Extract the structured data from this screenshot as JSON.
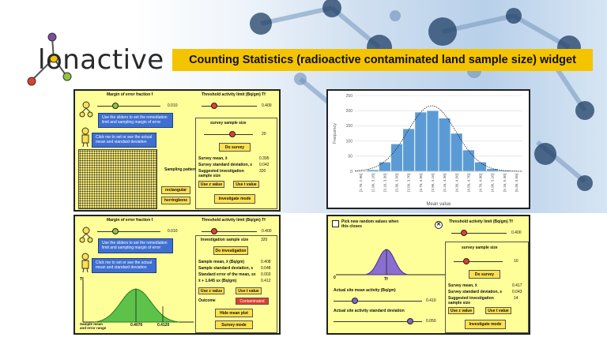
{
  "header": {
    "logo_text": "lonactive",
    "title": "Counting Statistics (radioactive contaminated land sample size) widget"
  },
  "colors": {
    "title_bg": "#f5c400",
    "panel_bg": "#ffff99",
    "button": "#ffe14d",
    "tip": "#3f6fd0",
    "contaminated": "#e0402e",
    "bar": "#5b9bd5",
    "curve": "#70ad47"
  },
  "panel1": {
    "margin_label": "Margin of error fraction f",
    "margin_value": "0.010",
    "threshold_label": "Threshold activity limit (Bq/gm) Tf",
    "threshold_value": "0.400",
    "tip1": "Use the sliders to set the remediation limit and sampling margin of error",
    "tip2": "Click me to set or see the actual mean and standard deviation",
    "sample_size_label": "survey sample size",
    "sample_size_value": "20",
    "do_survey": "Do survey",
    "survey_mean_label": "Survey mean, x̄",
    "survey_mean_value": "0.395",
    "survey_sd_label": "Survey standard deviation, s",
    "survey_sd_value": "0.042",
    "suggested_label": "Suggested investigation sample size",
    "suggested_value": "320",
    "use_z": "Use z value",
    "use_t": "Use t value",
    "investigate": "Investigate mode",
    "pattern_label": "Sampling pattern",
    "rectangular": "rectangular",
    "herringbone": "herringbone"
  },
  "panel2": {
    "margin_label": "Margin of error fraction f",
    "margin_value": "0.010",
    "threshold_label": "Threshold activity limit (Bq/gm) Tf",
    "threshold_value": "0.400",
    "tip1": "Use the sliders to set the remediation limit and sampling margin of error",
    "tip2": "Click me to set or see the actual mean and standard deviation",
    "inv_sample_label": "Investigation sample size",
    "inv_sample_value": "320",
    "do_investigation": "Do investigation",
    "sample_mean_label": "Sample mean, x̄ (Bq/gm)",
    "sample_mean_value": "0.408",
    "sample_sd_label": "Sample standard deviation, s",
    "sample_sd_value": "0.048",
    "se_label": "Standard error of the mean, sx",
    "se_value": "0.003",
    "x_plus_label": "x̄ + 1.645 sx (Bq/gm)",
    "x_plus_value": "0.412",
    "use_z": "Use z value",
    "use_t": "Use t value",
    "outcome_label": "Outcome",
    "outcome_value": "Contaminated",
    "hide_mean": "Hide mean plot",
    "survey_mode": "Survey mode",
    "tf_label": "Tf",
    "axis_label": "Sample mean and error range",
    "mean_marker": "0.4076",
    "upper_marker": "0.4120"
  },
  "panel3": {
    "checkbox_label": "Pick new random values when this closes",
    "threshold_label": "Threshold activity limit (Bq/gm) Tf",
    "threshold_value": "0.400",
    "sample_size_label": "survey sample size",
    "sample_size_value": "10",
    "do_survey": "Do survey",
    "survey_mean_label": "Survey mean, x̄",
    "survey_mean_value": "0.417",
    "survey_sd_label": "Survey standard deviation, s",
    "survey_sd_value": "0.043",
    "suggested_label": "Suggested investigation sample size",
    "suggested_value": "14",
    "use_z": "Use z value",
    "use_t": "Use t value",
    "investigate": "Investigate mode",
    "axis_zero": "0",
    "tf_label": "Tf",
    "site_mean_label": "Actual site mean activity (Bq/gm)",
    "site_mean_value": "0.410",
    "site_sd_label": "Actual site activity standard deviation",
    "site_sd_value": "0.050"
  },
  "chart_data": {
    "type": "bar",
    "title": "",
    "xlabel": "Mean value",
    "ylabel": "Frequency",
    "ylim": [
      0,
      250
    ],
    "yticks": [
      0,
      50,
      100,
      150,
      200,
      250
    ],
    "categories": [
      "[2.76, 2.96]",
      "(2.96, 3.16]",
      "(3.16, 3.36]",
      "(3.36, 3.56]",
      "(3.56, 3.76]",
      "(3.76, 3.96]",
      "(3.96, 4.16]",
      "(4.16, 4.36]",
      "(4.36, 4.56]",
      "(4.56, 4.76]",
      "(4.76, 4.96]",
      "(4.96, 5.16]",
      "(5.16, 5.36]",
      "(5.36, 5.56]"
    ],
    "values": [
      2,
      5,
      30,
      90,
      140,
      195,
      200,
      175,
      125,
      70,
      30,
      8,
      3,
      1
    ],
    "grid": true,
    "normal_fit": true
  }
}
